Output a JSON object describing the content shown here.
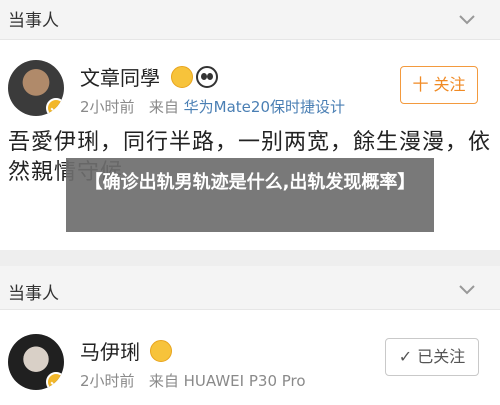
{
  "section1": {
    "title": "当事人"
  },
  "post1": {
    "name": "文章同學",
    "time": "2小时前",
    "source_prefix": "来自",
    "source": "华为Mate20保时捷设计",
    "follow_label": "十 关注",
    "text": "吾愛伊琍，同行半路，一别两宽，餘生漫漫，依然親情守候"
  },
  "overlay": {
    "text": "【确诊出轨男轨迹是什么,出轨发现概率】"
  },
  "section2": {
    "title": "当事人"
  },
  "post2": {
    "name": "马伊琍",
    "time": "2小时前",
    "source_prefix": "来自",
    "source": "HUAWEI P30 Pro",
    "follow_label": "✓ 已关注"
  },
  "colors": {
    "follow_orange": "#f08a24",
    "link_blue": "#4a7fb4",
    "badge_gold": "#f2b72b"
  },
  "icons": [
    "chevron-down-icon",
    "verified-badge-icon",
    "crown-emoji-icon",
    "panda-emoji-icon"
  ]
}
